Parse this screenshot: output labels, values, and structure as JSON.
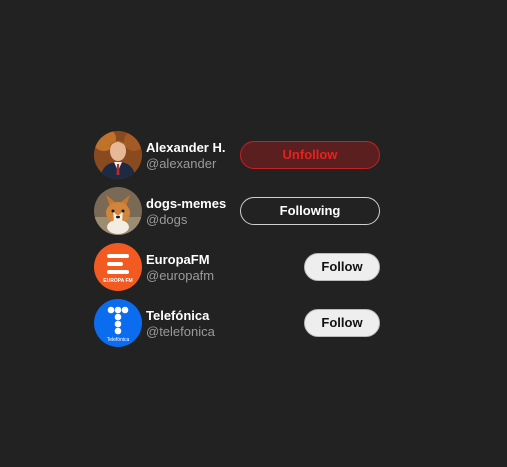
{
  "accounts": [
    {
      "name": "Alexander H.",
      "handle": "@alexander",
      "avatar_icon": "person-portrait-avatar",
      "button_label": "Unfollow",
      "button_state": "hover-unfollow"
    },
    {
      "name": "dogs-memes",
      "handle": "@dogs",
      "avatar_icon": "corgi-dog-avatar",
      "button_label": "Following",
      "button_state": "following"
    },
    {
      "name": "EuropaFM",
      "handle": "@europafm",
      "avatar_icon": "europafm-logo-avatar",
      "avatar_logo_text": "EUROPA FM",
      "button_label": "Follow",
      "button_state": "not-following"
    },
    {
      "name": "Telefónica",
      "handle": "@telefonica",
      "avatar_icon": "telefonica-logo-avatar",
      "avatar_logo_text": "Telefónica",
      "button_label": "Follow",
      "button_state": "not-following"
    }
  ],
  "colors": {
    "background": "#222222",
    "unfollow_red": "#e8201e",
    "europafm_orange": "#f25a22",
    "telefonica_blue": "#0b6cf0"
  }
}
